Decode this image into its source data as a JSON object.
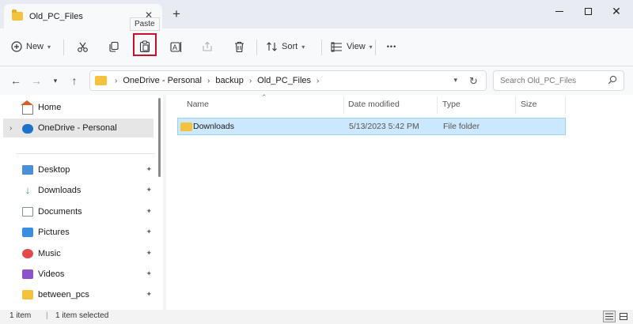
{
  "window": {
    "tab_title": "Old_PC_Files",
    "tab_close": "✕",
    "new_tab": "+"
  },
  "toolbar": {
    "new_label": "New",
    "sort_label": "Sort",
    "view_label": "View",
    "more_label": "•••",
    "tooltip": "Paste",
    "highlight_color": "#c8102e"
  },
  "address": {
    "crumbs": [
      "OneDrive - Personal",
      "backup",
      "Old_PC_Files"
    ],
    "search_placeholder": "Search Old_PC_Files"
  },
  "nav": {
    "items": [
      {
        "label": "Home",
        "icon": "home-icon"
      },
      {
        "label": "OneDrive - Personal",
        "icon": "cloud-icon"
      },
      {
        "label": "Desktop",
        "icon": "desktop-icon"
      },
      {
        "label": "Downloads",
        "icon": "download-icon"
      },
      {
        "label": "Documents",
        "icon": "document-icon"
      },
      {
        "label": "Pictures",
        "icon": "pictures-icon"
      },
      {
        "label": "Music",
        "icon": "music-icon"
      },
      {
        "label": "Videos",
        "icon": "video-icon"
      },
      {
        "label": "between_pcs",
        "icon": "folder-icon"
      }
    ]
  },
  "files": {
    "columns": [
      "Name",
      "Date modified",
      "Type",
      "Size"
    ],
    "rows": [
      {
        "name": "Downloads",
        "date": "5/13/2023 5:42 PM",
        "type": "File folder",
        "size": ""
      }
    ]
  },
  "status": {
    "count": "1 item",
    "selected": "1 item selected"
  }
}
